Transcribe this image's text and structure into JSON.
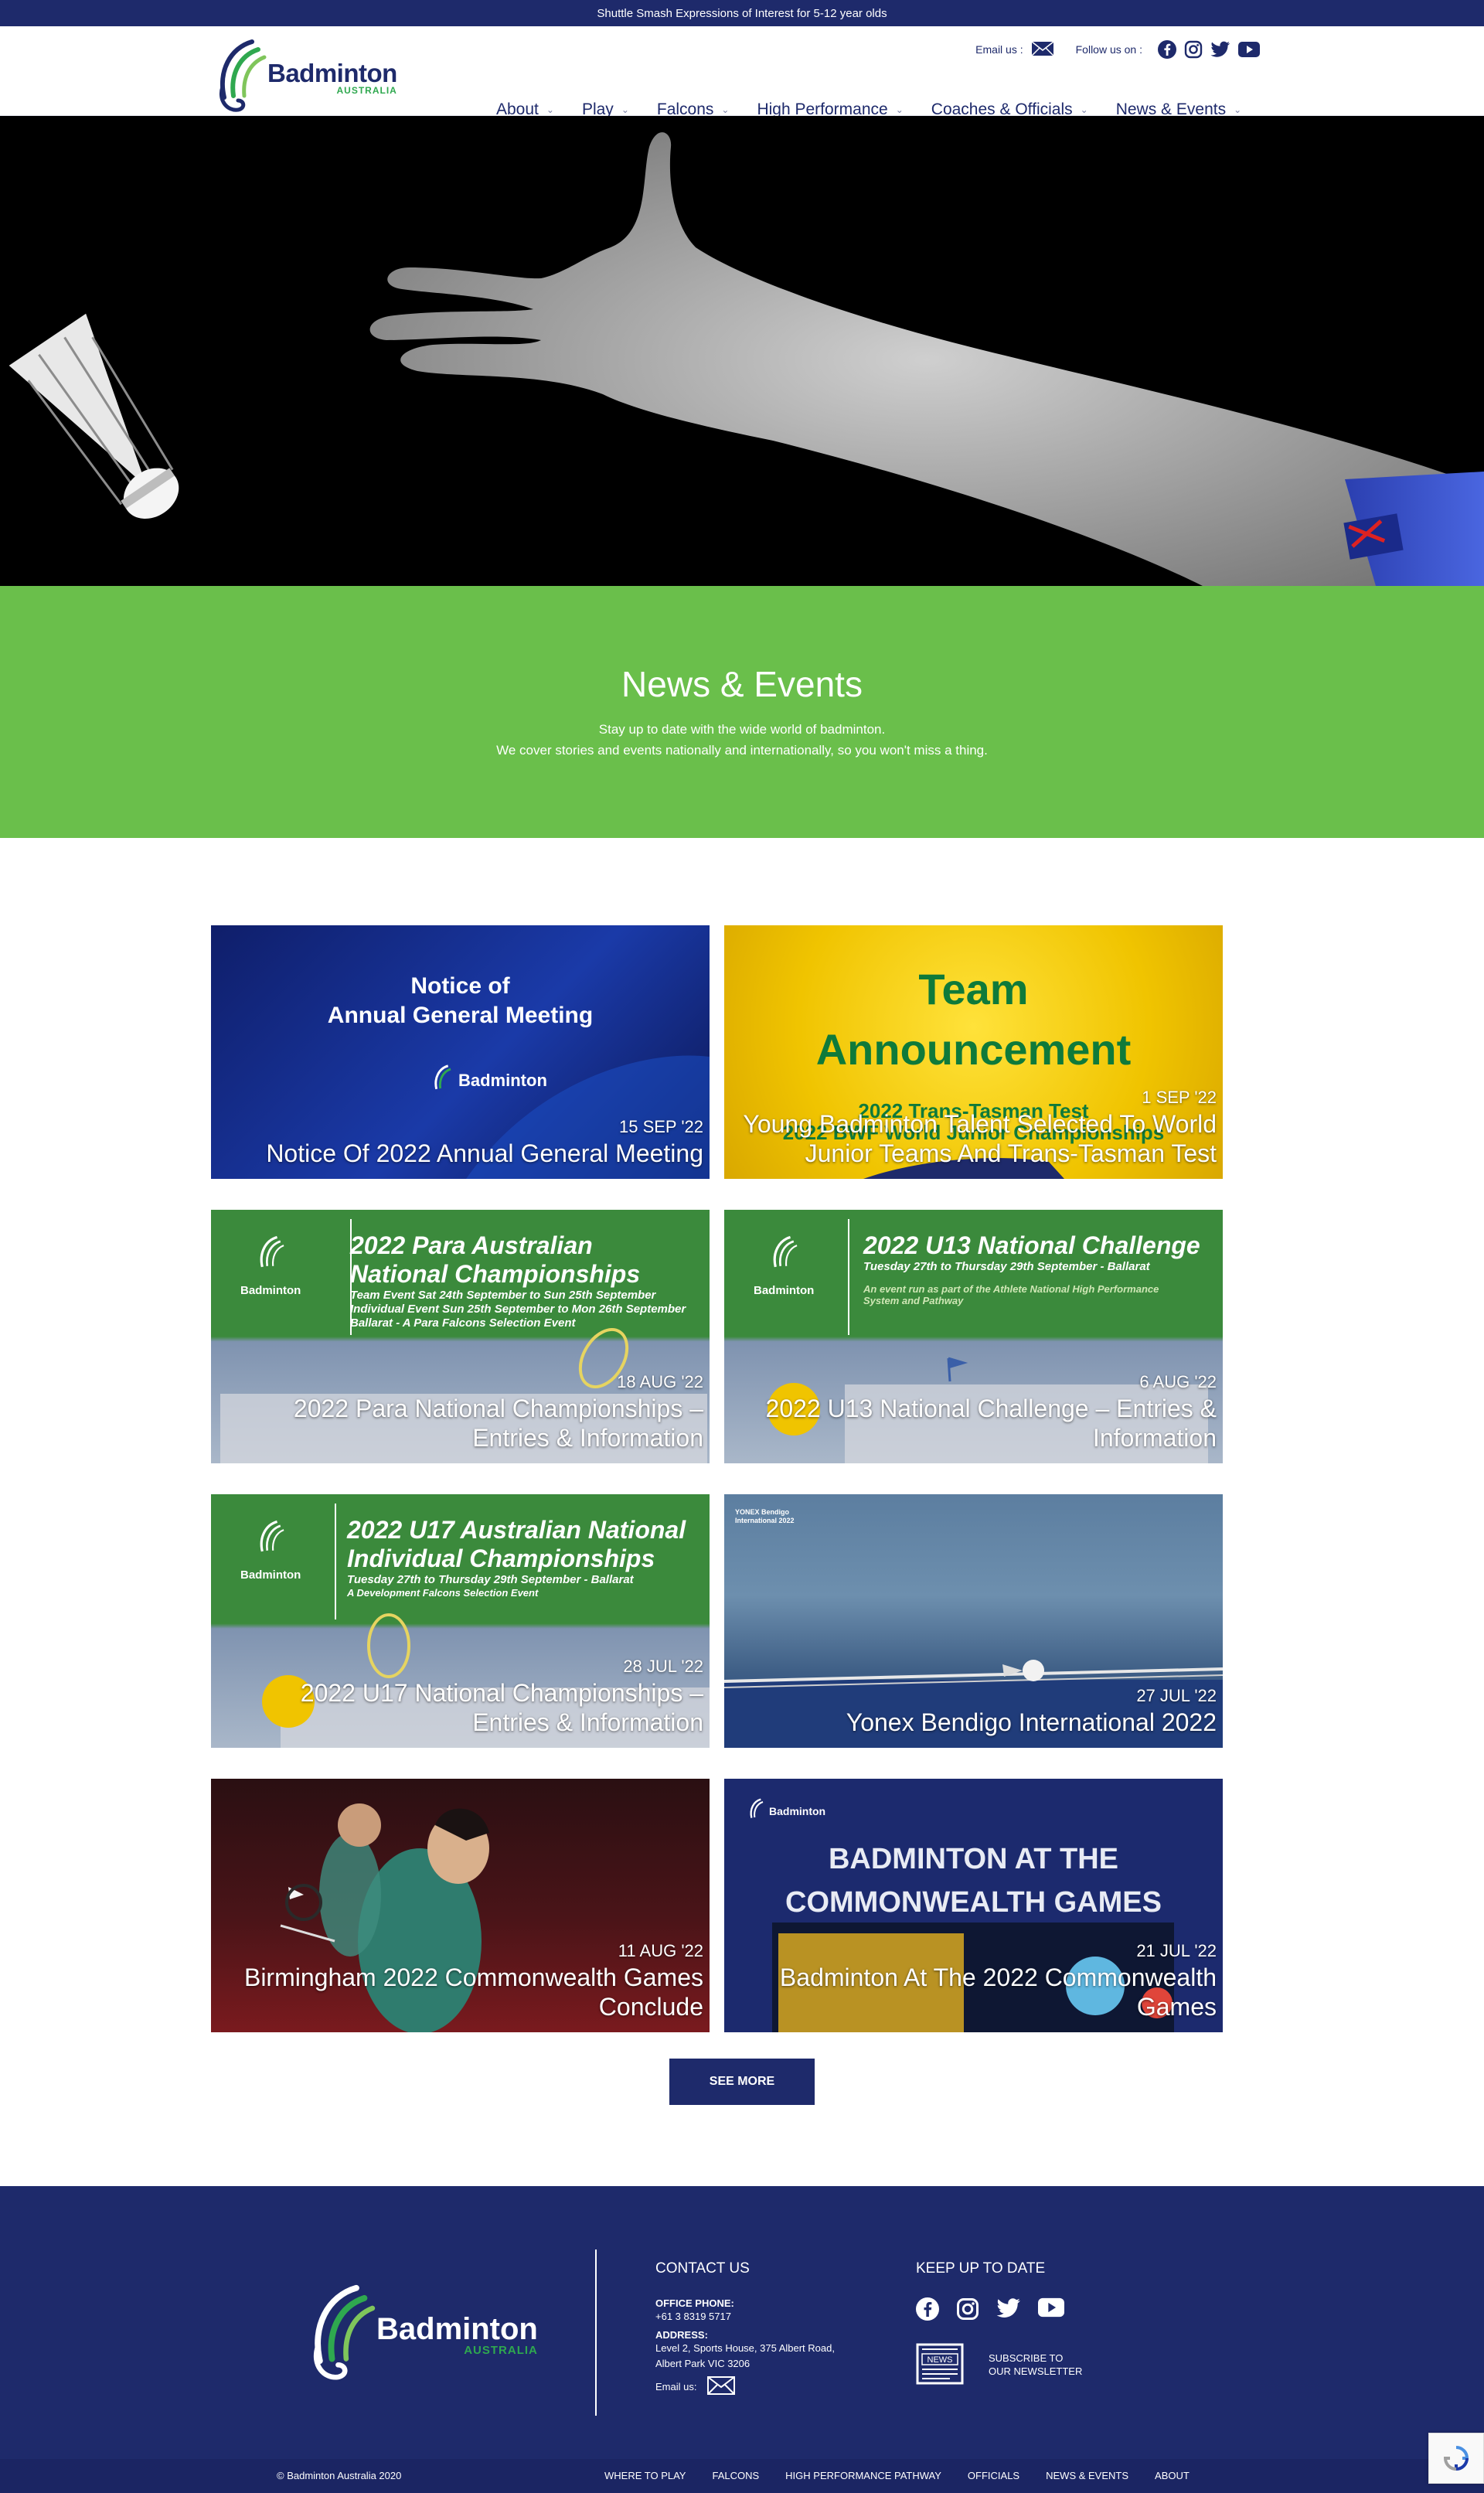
{
  "topbar": {
    "text": "Shuttle Smash Expressions of Interest for 5-12 year olds"
  },
  "header": {
    "logo_word": "Badminton",
    "logo_sub": "AUSTRALIA",
    "email_label": "Email us :",
    "follow_label": "Follow us on :",
    "nav": [
      "About",
      "Play",
      "Falcons",
      "High Performance",
      "Coaches & Officials",
      "News & Events"
    ]
  },
  "band": {
    "title": "News & Events",
    "line1": "Stay up to date with the wide world of badminton.",
    "line2": "We cover stories and events nationally and internationally, so you won't miss a thing."
  },
  "cards": [
    {
      "date": "15 SEP '22",
      "title": "Notice Of 2022 Annual General Meeting",
      "img_h1": "Notice of",
      "img_h2": "Annual General Meeting",
      "img_logo": "Badminton"
    },
    {
      "date": "1 SEP '22",
      "title": "Young Badminton Talent Selected To World Junior Teams And Trans-Tasman Test",
      "img_h1": "Team",
      "img_h2": "Announcement",
      "img_l1": "2022 Trans-Tasman Test",
      "img_l2": "2022 BWF World Junior Championships"
    },
    {
      "date": "18 AUG '22",
      "title": "2022 Para National Championships – Entries & Information",
      "img_h1": "2022 Para Australian",
      "img_h2": "National Championships",
      "img_l1": "Team Event Sat 24th September to Sun 25th September",
      "img_l2": "Individual Event Sun 25th September to Mon 26th September",
      "img_l3": "Ballarat - A Para Falcons Selection Event",
      "img_logo": "Badminton"
    },
    {
      "date": "6 AUG '22",
      "title": "2022 U13 National Challenge – Entries & Information",
      "img_h1": "2022 U13 National Challenge",
      "img_l1": "Tuesday 27th to Thursday 29th September - Ballarat",
      "img_l2": "An event run as part of the Athlete National High Performance",
      "img_l3": "System and Pathway",
      "img_logo": "Badminton"
    },
    {
      "date": "28 JUL '22",
      "title": "2022 U17 National Championships – Entries & Information",
      "img_h1": "2022 U17 Australian National",
      "img_h2": "Individual Championships",
      "img_l1": "Tuesday 27th to Thursday 29th September - Ballarat",
      "img_l2": "A Development Falcons Selection Event",
      "img_logo": "Badminton"
    },
    {
      "date": "27 JUL '22",
      "title": "Yonex Bendigo International 2022",
      "img_l1": "YONEX Bendigo",
      "img_l2": "International 2022"
    },
    {
      "date": "11 AUG '22",
      "title": "Birmingham 2022 Commonwealth Games Conclude"
    },
    {
      "date": "21 JUL '22",
      "title": "Badminton At The 2022 Commonwealth Games",
      "img_h1": "BADMINTON AT THE",
      "img_h2": "COMMONWEALTH GAMES",
      "img_logo": "Badminton"
    }
  ],
  "see_more": "SEE MORE",
  "footer": {
    "logo_word": "Badminton",
    "logo_sub": "AUSTRALIA",
    "contact_title": "CONTACT US",
    "phone_label": "OFFICE PHONE:",
    "phone": "+61 3 8319 5717",
    "address_label": "ADDRESS:",
    "address1": "Level 2, Sports House, 375 Albert Road,",
    "address2": "Albert Park VIC 3206",
    "email_label": "Email us:",
    "keep_title": "KEEP UP TO DATE",
    "news_icon_text": "NEWS",
    "subscribe1": "SUBSCRIBE TO",
    "subscribe2": "OUR NEWSLETTER"
  },
  "bottom": {
    "copyright": "© Badminton Australia 2020",
    "links": [
      "WHERE TO PLAY",
      "FALCONS",
      "HIGH PERFORMANCE PATHWAY",
      "OFFICIALS",
      "NEWS & EVENTS",
      "ABOUT"
    ]
  },
  "colors": {
    "navy": "#1e2a6b",
    "green": "#6abf4b",
    "brand_green": "#2fa84f"
  }
}
